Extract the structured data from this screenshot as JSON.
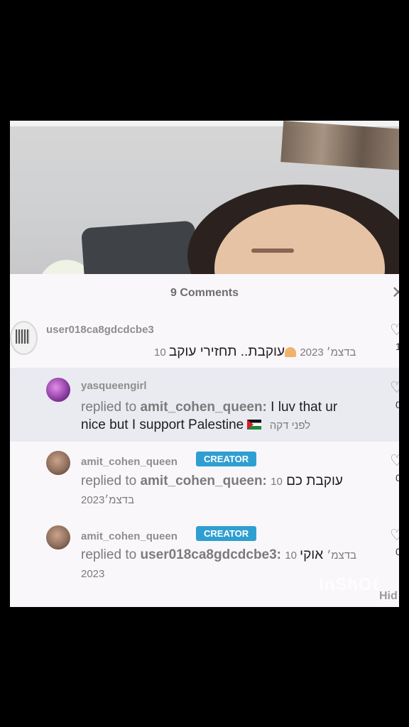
{
  "sheet": {
    "title": "9 Comments",
    "close_icon": "close-icon"
  },
  "comments": [
    {
      "username": "user018ca8gdcdcbe3",
      "text_he": "עוקבת.. תחזירי עוקב",
      "date": "10 בדצמ׳ 2023",
      "like_count": "1"
    },
    {
      "username": "yasqueengirl",
      "reply_prefix": "replied to",
      "reply_target": "amit_cohen_queen:",
      "text": "I luv that ur nice but I  support Palestine",
      "time": "לפני דקה",
      "like_count": "0"
    },
    {
      "username": "amit_cohen_queen",
      "badge": "CREATOR",
      "reply_prefix": "replied to",
      "reply_target": "amit_cohen_queen:",
      "text": "עוקבת כם",
      "date_day": "10",
      "date_rest": "בדצמ׳2023",
      "like_count": "0"
    },
    {
      "username": "amit_cohen_queen",
      "badge": "CREATOR",
      "reply_prefix": "replied to",
      "reply_target": "user018ca8gdcdcbe3:",
      "text": "אוקי",
      "date": "10 בדצמ׳",
      "year": "2023",
      "like_count": "0"
    }
  ],
  "watermark": "InShOt",
  "hide_label": "Hid"
}
